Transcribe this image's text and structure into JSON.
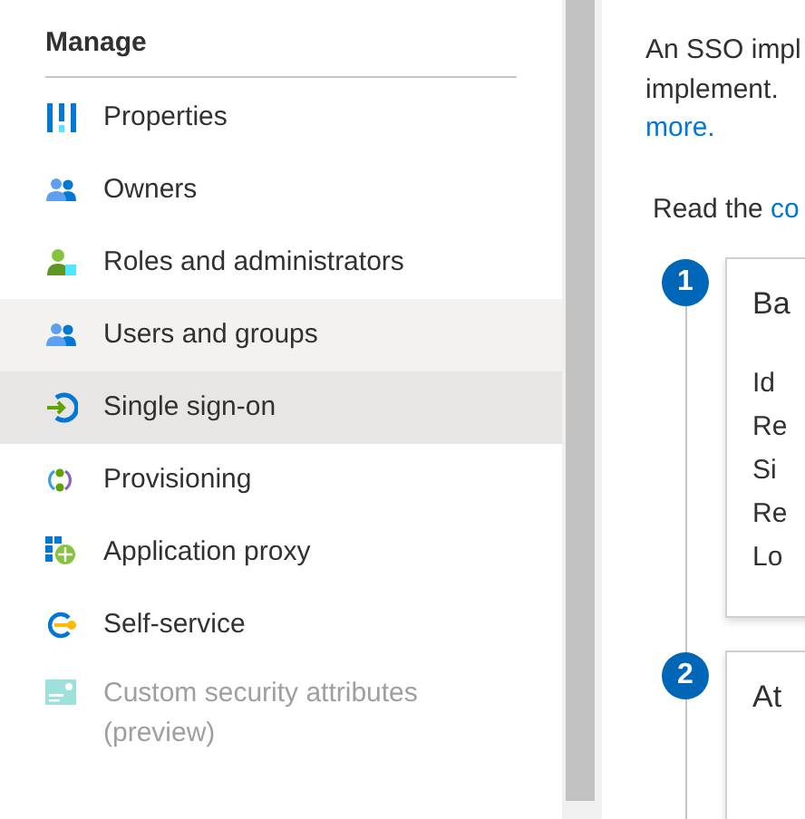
{
  "sidebar": {
    "section_title": "Manage",
    "items": [
      {
        "label": "Properties",
        "kind": "properties",
        "selected": false,
        "hovered": false,
        "disabled": false
      },
      {
        "label": "Owners",
        "kind": "people",
        "selected": false,
        "hovered": false,
        "disabled": false
      },
      {
        "label": "Roles and administrators",
        "kind": "admin",
        "selected": false,
        "hovered": false,
        "disabled": false
      },
      {
        "label": "Users and groups",
        "kind": "people",
        "selected": false,
        "hovered": true,
        "disabled": false
      },
      {
        "label": "Single sign-on",
        "kind": "sso",
        "selected": true,
        "hovered": false,
        "disabled": false
      },
      {
        "label": "Provisioning",
        "kind": "provisioning",
        "selected": false,
        "hovered": false,
        "disabled": false
      },
      {
        "label": "Application proxy",
        "kind": "proxy",
        "selected": false,
        "hovered": false,
        "disabled": false
      },
      {
        "label": "Self-service",
        "kind": "selfservice",
        "selected": false,
        "hovered": false,
        "disabled": false
      },
      {
        "label": "Custom security attributes (preview)",
        "kind": "security",
        "selected": false,
        "hovered": false,
        "disabled": true
      }
    ]
  },
  "main": {
    "intro_lines": [
      "An SSO impl",
      "implement."
    ],
    "intro_link": "more.",
    "read_text": "Read the ",
    "read_link": "co",
    "steps": [
      {
        "number": "1",
        "title": "Ba",
        "lines": [
          "Id",
          "Re",
          "Si",
          "Re",
          "Lo"
        ]
      },
      {
        "number": "2",
        "title": "At"
      }
    ]
  }
}
